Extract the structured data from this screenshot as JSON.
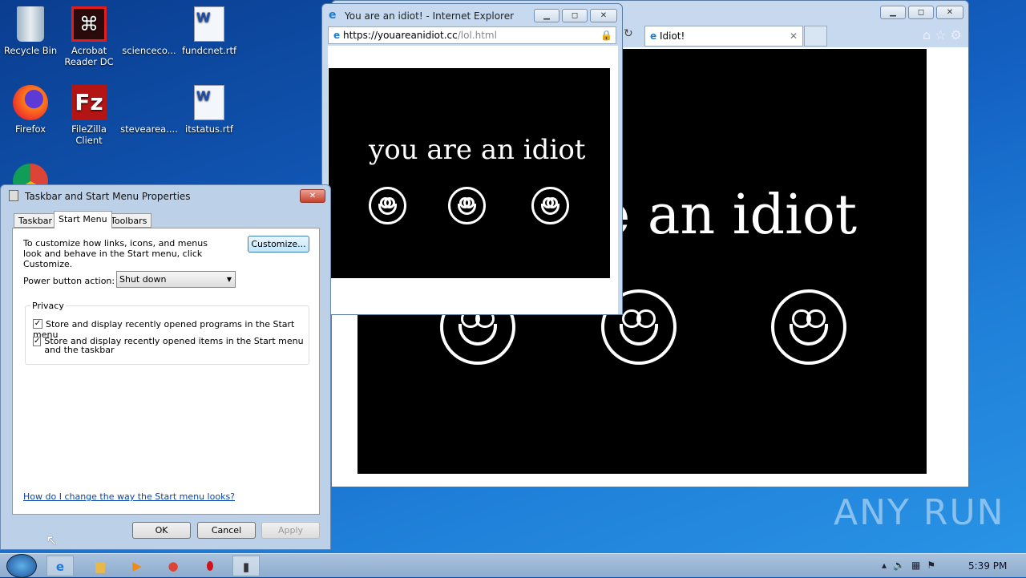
{
  "desktop": {
    "icons": [
      {
        "label": "Recycle Bin",
        "glyph": "recycle-bin"
      },
      {
        "label": "Acrobat Reader DC",
        "glyph": "acrobat"
      },
      {
        "label": "scienceco...",
        "glyph": "file"
      },
      {
        "label": "fundcnet.rtf",
        "glyph": "word"
      },
      {
        "label": "Firefox",
        "glyph": "firefox"
      },
      {
        "label": "FileZilla Client",
        "glyph": "filezilla"
      },
      {
        "label": "stevearea....",
        "glyph": "file"
      },
      {
        "label": "itstatus.rtf",
        "glyph": "word"
      },
      {
        "label": "",
        "glyph": "chrome"
      }
    ]
  },
  "ie_main": {
    "tab_label": "Idiot!",
    "big_text": "e an idiot"
  },
  "ie_popup": {
    "title": "You are an idiot! - Internet Explorer",
    "url_host": "https://youareanidiot.cc",
    "url_path": "/lol.html",
    "text": "you are an idiot"
  },
  "dialog": {
    "title": "Taskbar and Start Menu Properties",
    "tabs": [
      "Taskbar",
      "Start Menu",
      "Toolbars"
    ],
    "active_tab": "Start Menu",
    "description": "To customize how links, icons, and menus look and behave in the Start menu, click Customize.",
    "customize": "Customize...",
    "power_label": "Power button action:",
    "power_value": "Shut down",
    "privacy_legend": "Privacy",
    "privacy_items": [
      "Store and display recently opened programs in the Start menu",
      "Store and display recently opened items in the Start menu and the taskbar"
    ],
    "help_link": "How do I change the way the Start menu looks?",
    "ok": "OK",
    "cancel": "Cancel",
    "apply": "Apply"
  },
  "taskbar": {
    "time": "5:39 PM"
  },
  "watermark": "ANY RUN"
}
